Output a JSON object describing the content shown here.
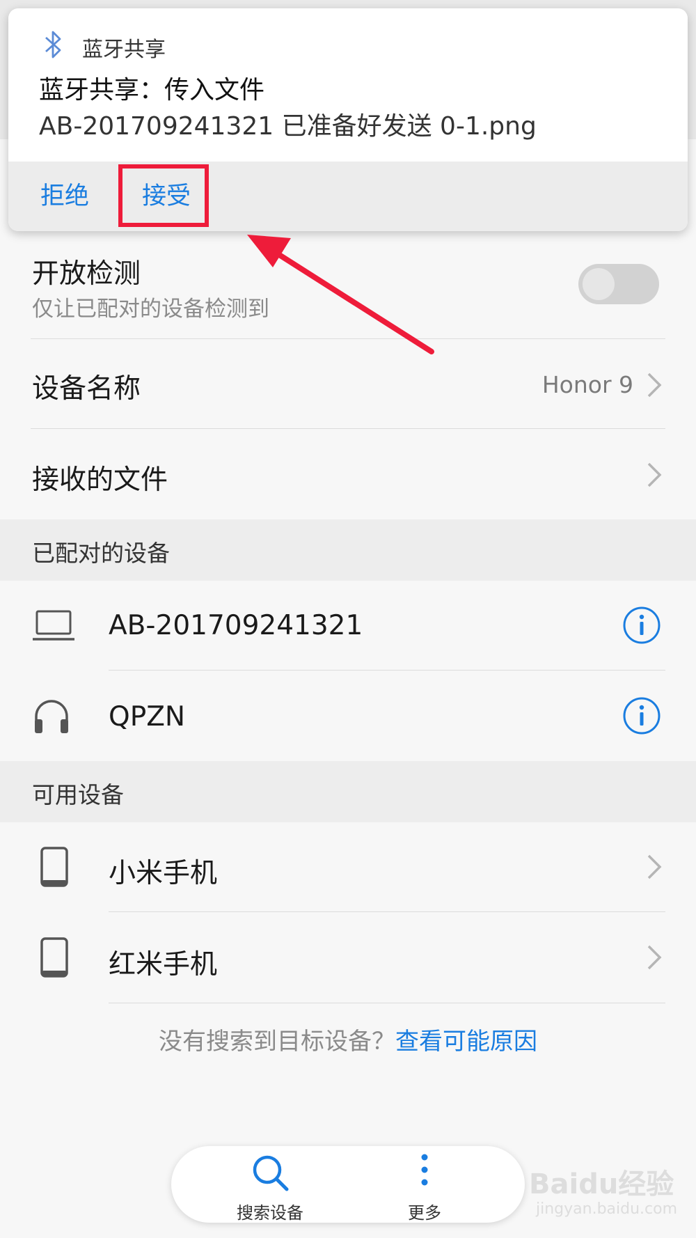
{
  "notification": {
    "app_name": "蓝牙共享",
    "title": "蓝牙共享：传入文件",
    "body": "AB-201709241321 已准备好发送 0-1.png",
    "reject_label": "拒绝",
    "accept_label": "接受"
  },
  "settings": {
    "open_detection": {
      "title": "开放检测",
      "subtitle": "仅让已配对的设备检测到",
      "enabled": false
    },
    "device_name": {
      "title": "设备名称",
      "value": "Honor 9"
    },
    "received_files": {
      "title": "接收的文件"
    }
  },
  "paired_devices": {
    "header": "已配对的设备",
    "items": [
      {
        "name": "AB-201709241321",
        "icon": "laptop-icon"
      },
      {
        "name": "QPZN",
        "icon": "headphones-icon"
      }
    ]
  },
  "available_devices": {
    "header": "可用设备",
    "items": [
      {
        "name": "小米手机",
        "icon": "phone-icon"
      },
      {
        "name": "红米手机",
        "icon": "phone-icon"
      }
    ]
  },
  "hint": {
    "text": "没有搜索到目标设备？",
    "link": "查看可能原因"
  },
  "bottom_bar": {
    "search_label": "搜索设备",
    "more_label": "更多"
  },
  "watermark": {
    "logo": "Baidu经验",
    "url": "jingyan.baidu.com"
  },
  "colors": {
    "accent": "#1a7de0",
    "annotation": "#ee1c3a",
    "background": "#f7f7f7",
    "section_header": "#ededed"
  }
}
